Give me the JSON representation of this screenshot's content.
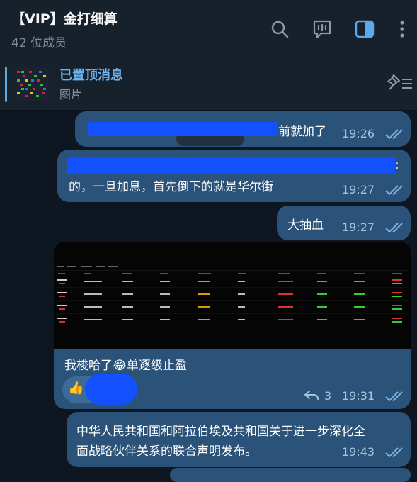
{
  "header": {
    "title": "【VIP】金打细算",
    "member_count": "42 位成员",
    "icons": [
      "search-icon",
      "video-chat-icon",
      "sidebar-toggle-icon",
      "more-vertical-icon"
    ]
  },
  "pinned": {
    "title": "已置顶消息",
    "subtitle": "图片"
  },
  "messages": [
    {
      "text": "前就加了",
      "time": "19:26",
      "status": "read"
    },
    {
      "text": "的，一旦加息，首先倒下的就是华尔街",
      "time": "19:27",
      "status": "read"
    },
    {
      "text": "大抽血",
      "time": "19:27",
      "status": "read"
    },
    {
      "text": "我梭哈了😂单逐级止盈",
      "time": "19:31",
      "status": "read",
      "replies": "3",
      "reaction": "👍",
      "has_image": true
    },
    {
      "text_line1": "中华人民共和国和阿拉伯埃及共和国关于进一步深化全",
      "text_line2": "面战略伙伴关系的联合声明发布。",
      "time": "19:43",
      "status": "read"
    }
  ],
  "colors": {
    "background": "#0e1621",
    "header": "#17212b",
    "bubble_out": "#2b5278",
    "accent": "#6ab3f3",
    "redaction": "#1350ff"
  }
}
